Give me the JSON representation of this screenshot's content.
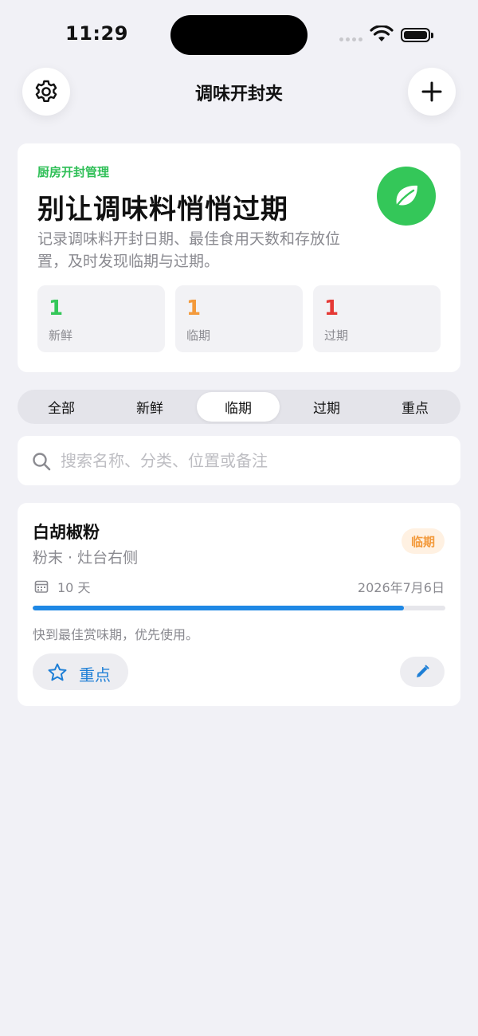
{
  "status_bar": {
    "time": "11:29"
  },
  "nav": {
    "title": "调味开封夹",
    "settings_icon": "gear-icon",
    "add_icon": "plus-icon"
  },
  "hero": {
    "eyebrow": "厨房开封管理",
    "title": "别让调味料悄悄过期",
    "description": "记录调味料开封日期、最佳食用天数和存放位置，及时发现临期与过期。",
    "badge_icon": "leaf-icon",
    "stats": [
      {
        "value": "1",
        "label": "新鲜",
        "color": "#34C759"
      },
      {
        "value": "1",
        "label": "临期",
        "color": "#F39A3C"
      },
      {
        "value": "1",
        "label": "过期",
        "color": "#E53935"
      }
    ]
  },
  "filters": {
    "tabs": [
      "全部",
      "新鲜",
      "临期",
      "过期",
      "重点"
    ],
    "selected": "临期"
  },
  "search": {
    "placeholder": "搜索名称、分类、位置或备注",
    "value": ""
  },
  "items": [
    {
      "name": "白胡椒粉",
      "meta": "粉末 · 灶台右侧",
      "status": "临期",
      "days": "10 天",
      "date": "2026年7月6日",
      "progress": 0.9,
      "note": "快到最佳赏味期，优先使用。",
      "pin_label": "重点"
    }
  ],
  "colors": {
    "accent_green": "#34C759",
    "accent_blue": "#1E88E5",
    "warning_orange": "#F39A3C",
    "danger_red": "#E53935"
  }
}
